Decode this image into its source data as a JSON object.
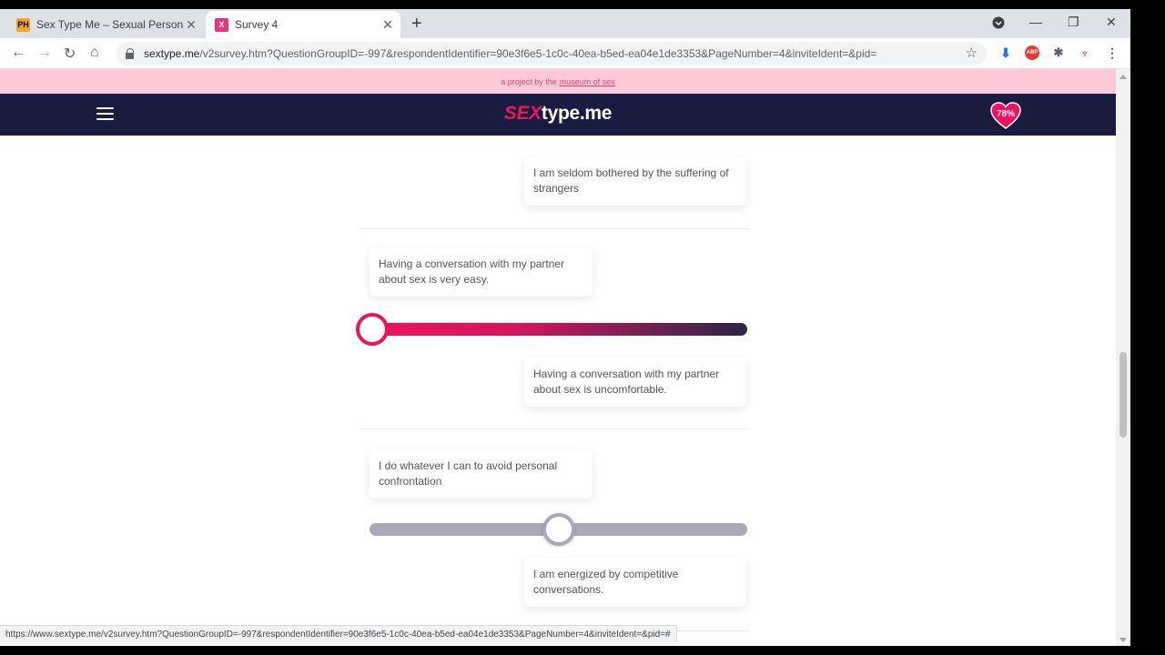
{
  "browser": {
    "tabs": [
      {
        "favicon": "PH",
        "title": "Sex Type Me – Sexual Personality",
        "active": false
      },
      {
        "favicon": "X",
        "title": "Survey 4",
        "active": true
      }
    ],
    "new_tab": "+",
    "url_host": "sextype.me",
    "url_path": "/v2survey.htm?QuestionGroupID=-997&respondentIdentifier=90e3f6e5-1c0c-40ea-b5ed-ea04e1de3353&PageNumber=4&inviteIdent=&pid=",
    "status_url": "https://www.sextype.me/v2survey.htm?QuestionGroupID=-997&respondentIdentifier=90e3f6e5-1c0c-40ea-b5ed-ea04e1de3353&PageNumber=4&inviteIdent=&pid=#"
  },
  "site": {
    "promo_text": "a project by the",
    "promo_link": "museum of sex",
    "logo_accent": "SEX",
    "logo_rest": "type.me",
    "progress_badge": "78%",
    "colors": {
      "navy": "#1a1c3f",
      "pink": "#f2115e",
      "promo_bg": "#ffc9da"
    }
  },
  "questions": [
    {
      "right_statement": "I am seldom bothered by the suffering of strangers"
    },
    {
      "left_statement": "Having a conversation with my partner about sex is very easy.",
      "right_statement": "Having a conversation with my partner about sex is uncomfortable.",
      "slider_value": 0,
      "answered": true
    },
    {
      "left_statement": "I do whatever I can to avoid personal confrontation",
      "right_statement": "I am energized by competitive conversations.",
      "slider_value": 0.5,
      "answered": false
    }
  ]
}
